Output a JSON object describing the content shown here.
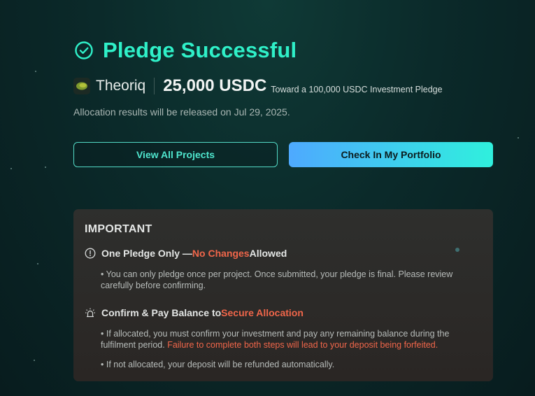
{
  "header": {
    "title": "Pledge Successful",
    "status_icon": "check-circle-icon",
    "accent": "#2ff0c8"
  },
  "project": {
    "name": "Theoriq",
    "amount": "25,000 USDC",
    "amount_note": "Toward a 100,000 USDC Investment Pledge"
  },
  "release_text": "Allocation results will be released on Jul 29, 2025.",
  "buttons": {
    "view_all": "View All Projects",
    "portfolio": "Check In My Portfolio"
  },
  "important": {
    "title": "IMPORTANT",
    "section1": {
      "icon": "exclamation-circle-icon",
      "prefix": "One Pledge Only — ",
      "highlight": "No Changes",
      "suffix": " Allowed",
      "bullet": "• You can only pledge once per project. Once submitted, your pledge is final. Please review carefully before confirming."
    },
    "section2": {
      "icon": "alarm-siren-icon",
      "prefix": "Confirm & Pay Balance to ",
      "highlight": "Secure Allocation",
      "bullet1": "• If allocated, you must confirm your investment and pay any remaining balance during the fulfilment period. ",
      "bullet1_warning": "Failure to complete both steps will lead to your deposit being forfeited.",
      "bullet2": "• If not allocated, your deposit will be refunded automatically."
    },
    "highlight_color": "#f0664a"
  }
}
